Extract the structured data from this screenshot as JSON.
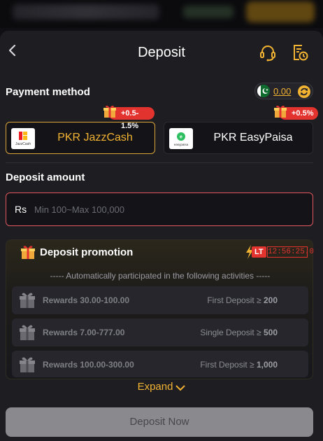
{
  "header": {
    "title": "Deposit"
  },
  "payment": {
    "title": "Payment method",
    "balance": "0.00",
    "methods": [
      {
        "label": "PKR JazzCash",
        "badge": "+0.5-1.5%",
        "logo_text": "JazzCash",
        "selected": true
      },
      {
        "label": "PKR EasyPaisa",
        "badge": "+0.5%",
        "logo_text": "easypaisa",
        "selected": false
      }
    ]
  },
  "amount": {
    "title": "Deposit amount",
    "prefix": "Rs",
    "placeholder": "Min 100~Max 100,000"
  },
  "promotion": {
    "title": "Deposit promotion",
    "tag": "LT",
    "timer": "12:56:25.0",
    "subtitle": "----- Automatically participated in the following activities -----",
    "rewards": [
      {
        "label": "Rewards 30.00-100.00",
        "condition": "First Deposit ≥",
        "amount": "200"
      },
      {
        "label": "Rewards 7.00-777.00",
        "condition": "Single Deposit ≥",
        "amount": "500"
      },
      {
        "label": "Rewards 100.00-300.00",
        "condition": "First Deposit ≥",
        "amount": "1,000"
      }
    ],
    "expand_label": "Expand"
  },
  "submit_label": "Deposit Now",
  "colors": {
    "accent": "#f3b332",
    "danger": "#e2332e",
    "surface": "#1d1d22"
  }
}
